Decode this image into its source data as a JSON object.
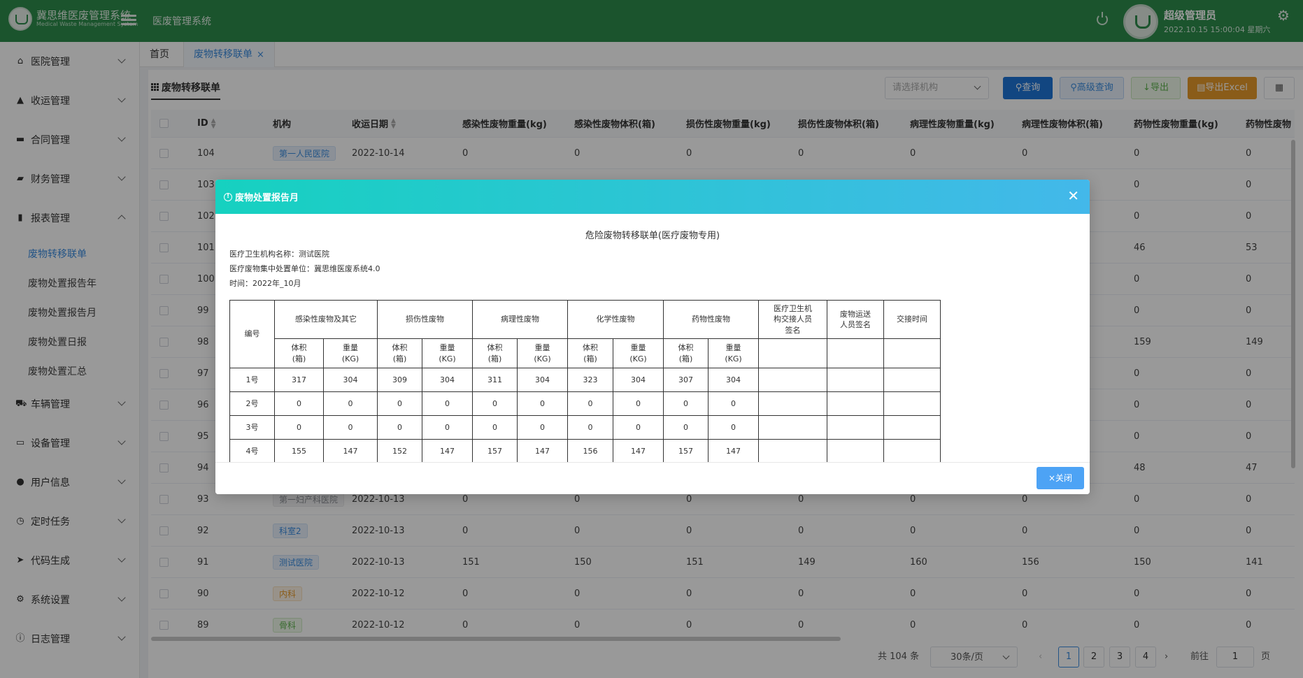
{
  "header": {
    "logo_title": "冀思维医废管理系统",
    "logo_subtitle": "Medical Waste Management System",
    "system_title": "医废管理系统",
    "user_name": "超级管理员",
    "datetime": "2022.10.15 15:00:04 星期六",
    "brand_color": "#2d8c4c"
  },
  "sidebar": {
    "items": [
      {
        "label": "医院管理",
        "icon": "home-icon"
      },
      {
        "label": "收运管理",
        "icon": "chart-area-icon"
      },
      {
        "label": "合同管理",
        "icon": "briefcase-icon"
      },
      {
        "label": "财务管理",
        "icon": "wallet-icon"
      },
      {
        "label": "报表管理",
        "icon": "bar-chart-icon"
      },
      {
        "label": "车辆管理",
        "icon": "truck-icon"
      },
      {
        "label": "设备管理",
        "icon": "monitor-icon"
      },
      {
        "label": "用户信息",
        "icon": "user-icon"
      },
      {
        "label": "定时任务",
        "icon": "clock-icon"
      },
      {
        "label": "代码生成",
        "icon": "send-icon"
      },
      {
        "label": "系统设置",
        "icon": "cog-icon"
      },
      {
        "label": "日志管理",
        "icon": "info-icon"
      }
    ],
    "report_sub": [
      "废物转移联单",
      "废物处置报告年",
      "废物处置报告月",
      "废物处置日报",
      "废物处置汇总"
    ]
  },
  "tabs": {
    "home": "首页",
    "active": "废物转移联单",
    "close": "×"
  },
  "toolbar": {
    "panel_title": "废物转移联单",
    "org_placeholder": "请选择机构",
    "query": "查询",
    "advanced": "高级查询",
    "export": "导出",
    "export_excel": "导出Excel"
  },
  "table": {
    "headers": [
      "ID",
      "机构",
      "收运日期",
      "感染性废物重量(kg)",
      "感染性废物体积(箱)",
      "损伤性废物重量(kg)",
      "损伤性废物体积(箱)",
      "病理性废物重量(kg)",
      "病理性废物体积(箱)",
      "药物性废物重量(kg)",
      "药物性废物"
    ],
    "rows": [
      {
        "id": "104",
        "org": "第一人民医院",
        "tag": "blue",
        "date": "2022-10-14",
        "vals": [
          "0",
          "0",
          "0",
          "0",
          "0",
          "0",
          "0",
          "0"
        ]
      },
      {
        "id": "103",
        "org": "",
        "tag": "",
        "date": "",
        "vals": [
          "",
          "",
          "",
          "",
          "",
          "",
          "0",
          "0"
        ]
      },
      {
        "id": "102",
        "org": "",
        "tag": "",
        "date": "",
        "vals": [
          "",
          "",
          "",
          "",
          "",
          "",
          "0",
          "0"
        ]
      },
      {
        "id": "101",
        "org": "",
        "tag": "",
        "date": "",
        "vals": [
          "",
          "",
          "",
          "",
          "",
          "",
          "46",
          "53"
        ]
      },
      {
        "id": "100",
        "org": "",
        "tag": "",
        "date": "",
        "vals": [
          "",
          "",
          "",
          "",
          "",
          "",
          "0",
          "0"
        ]
      },
      {
        "id": "99",
        "org": "",
        "tag": "",
        "date": "",
        "vals": [
          "",
          "",
          "",
          "",
          "",
          "",
          "0",
          "0"
        ]
      },
      {
        "id": "98",
        "org": "",
        "tag": "",
        "date": "",
        "vals": [
          "",
          "",
          "",
          "",
          "",
          "",
          "159",
          "149"
        ]
      },
      {
        "id": "97",
        "org": "",
        "tag": "",
        "date": "",
        "vals": [
          "",
          "",
          "",
          "",
          "",
          "",
          "0",
          "0"
        ]
      },
      {
        "id": "96",
        "org": "",
        "tag": "",
        "date": "",
        "vals": [
          "",
          "",
          "",
          "",
          "",
          "",
          "0",
          "0"
        ]
      },
      {
        "id": "95",
        "org": "",
        "tag": "",
        "date": "",
        "vals": [
          "",
          "",
          "",
          "",
          "",
          "",
          "0",
          "0"
        ]
      },
      {
        "id": "94",
        "org": "",
        "tag": "",
        "date": "",
        "vals": [
          "",
          "",
          "",
          "",
          "",
          "",
          "48",
          "47"
        ]
      },
      {
        "id": "93",
        "org": "第一妇产科医院",
        "tag": "gray",
        "date": "2022-10-13",
        "vals": [
          "0",
          "0",
          "0",
          "0",
          "0",
          "0",
          "0",
          "0"
        ]
      },
      {
        "id": "92",
        "org": "科室2",
        "tag": "blue",
        "date": "2022-10-13",
        "vals": [
          "0",
          "0",
          "0",
          "0",
          "0",
          "0",
          "0",
          "0"
        ]
      },
      {
        "id": "91",
        "org": "测试医院",
        "tag": "blue",
        "date": "2022-10-13",
        "vals": [
          "151",
          "150",
          "151",
          "149",
          "160",
          "156",
          "150",
          "141"
        ]
      },
      {
        "id": "90",
        "org": "内科",
        "tag": "orange",
        "date": "2022-10-12",
        "vals": [
          "0",
          "0",
          "0",
          "0",
          "0",
          "0",
          "0",
          "0"
        ]
      },
      {
        "id": "89",
        "org": "骨科",
        "tag": "green",
        "date": "2022-10-12",
        "vals": [
          "0",
          "0",
          "0",
          "0",
          "0",
          "0",
          "0",
          "0"
        ]
      }
    ]
  },
  "pagination": {
    "total": "共 104 条",
    "page_size": "30条/页",
    "pages": [
      "1",
      "2",
      "3",
      "4"
    ],
    "current": "1",
    "goto_label": "前往",
    "goto_value": "1",
    "page_suffix": "页"
  },
  "dialog": {
    "title": "废物处置报告月",
    "report_title": "危险废物转移联单(医疗废物专用)",
    "institution": "医疗卫生机构名称：测试医院",
    "disposal_unit": "医疗废物集中处置单位：冀思维医废系统4.0",
    "period": "时间：2022年_10月",
    "col_no": "编号",
    "categories": [
      "感染性废物及其它",
      "损伤性废物",
      "病理性废物",
      "化学性废物",
      "药物性废物"
    ],
    "col_sign_inst": "医疗卫生机构交接人员签名",
    "col_sign_trans": "废物运送人员签名",
    "col_handover": "交接时间",
    "sub_volume": "体积(箱)",
    "sub_weight": "重量(KG)",
    "rows": [
      {
        "no": "1号",
        "vals": [
          "317",
          "304",
          "309",
          "304",
          "311",
          "304",
          "323",
          "304",
          "307",
          "304"
        ]
      },
      {
        "no": "2号",
        "vals": [
          "0",
          "0",
          "0",
          "0",
          "0",
          "0",
          "0",
          "0",
          "0",
          "0"
        ]
      },
      {
        "no": "3号",
        "vals": [
          "0",
          "0",
          "0",
          "0",
          "0",
          "0",
          "0",
          "0",
          "0",
          "0"
        ]
      },
      {
        "no": "4号",
        "vals": [
          "155",
          "147",
          "152",
          "147",
          "157",
          "147",
          "156",
          "147",
          "157",
          "147"
        ]
      }
    ],
    "close_button": "×关闭"
  }
}
